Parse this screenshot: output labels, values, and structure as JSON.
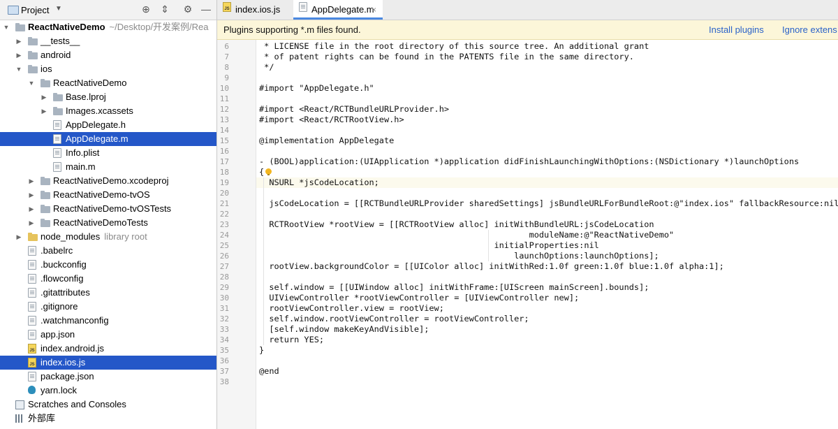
{
  "sidebar": {
    "title": "Project",
    "rows": [
      {
        "label": "ReactNativeDemo",
        "hint": "~/Desktop/开发案例/Rea",
        "bold": true,
        "depth": 0,
        "arrow": "down",
        "icon": "folder-icon",
        "iconKind": "folder"
      },
      {
        "label": "__tests__",
        "depth": 1,
        "arrow": "right",
        "icon": "folder-icon",
        "iconKind": "folder"
      },
      {
        "label": "android",
        "depth": 1,
        "arrow": "right",
        "icon": "folder-icon",
        "iconKind": "folder"
      },
      {
        "label": "ios",
        "depth": 1,
        "arrow": "down",
        "icon": "folder-icon",
        "iconKind": "folder"
      },
      {
        "label": "ReactNativeDemo",
        "depth": 2,
        "arrow": "down",
        "icon": "folder-icon",
        "iconKind": "folder"
      },
      {
        "label": "Base.lproj",
        "depth": 3,
        "arrow": "right",
        "icon": "folder-icon",
        "iconKind": "folder"
      },
      {
        "label": "Images.xcassets",
        "depth": 3,
        "arrow": "right",
        "icon": "folder-icon",
        "iconKind": "folder"
      },
      {
        "label": "AppDelegate.h",
        "depth": 3,
        "arrow": "",
        "icon": "file-icon",
        "iconKind": "file"
      },
      {
        "label": "AppDelegate.m",
        "depth": 3,
        "arrow": "",
        "icon": "file-icon",
        "iconKind": "file",
        "selected": true
      },
      {
        "label": "Info.plist",
        "depth": 3,
        "arrow": "",
        "icon": "file-icon",
        "iconKind": "file"
      },
      {
        "label": "main.m",
        "depth": 3,
        "arrow": "",
        "icon": "file-icon",
        "iconKind": "file"
      },
      {
        "label": "ReactNativeDemo.xcodeproj",
        "depth": 2,
        "arrow": "right",
        "icon": "folder-icon",
        "iconKind": "folder"
      },
      {
        "label": "ReactNativeDemo-tvOS",
        "depth": 2,
        "arrow": "right",
        "icon": "folder-icon",
        "iconKind": "folder"
      },
      {
        "label": "ReactNativeDemo-tvOSTests",
        "depth": 2,
        "arrow": "right",
        "icon": "folder-icon",
        "iconKind": "folder"
      },
      {
        "label": "ReactNativeDemoTests",
        "depth": 2,
        "arrow": "right",
        "icon": "folder-icon",
        "iconKind": "folder"
      },
      {
        "label": "node_modules",
        "hint": "library root",
        "depth": 1,
        "arrow": "right",
        "icon": "folder-icon",
        "iconKind": "folder yellow"
      },
      {
        "label": ".babelrc",
        "depth": 1,
        "arrow": "",
        "icon": "file-icon",
        "iconKind": "file"
      },
      {
        "label": ".buckconfig",
        "depth": 1,
        "arrow": "",
        "icon": "file-icon",
        "iconKind": "file"
      },
      {
        "label": ".flowconfig",
        "depth": 1,
        "arrow": "",
        "icon": "file-icon",
        "iconKind": "file"
      },
      {
        "label": ".gitattributes",
        "depth": 1,
        "arrow": "",
        "icon": "file-icon",
        "iconKind": "file"
      },
      {
        "label": ".gitignore",
        "depth": 1,
        "arrow": "",
        "icon": "file-icon",
        "iconKind": "file"
      },
      {
        "label": ".watchmanconfig",
        "depth": 1,
        "arrow": "",
        "icon": "file-icon",
        "iconKind": "file"
      },
      {
        "label": "app.json",
        "depth": 1,
        "arrow": "",
        "icon": "file-icon",
        "iconKind": "file"
      },
      {
        "label": "index.android.js",
        "depth": 1,
        "arrow": "",
        "icon": "js-file-icon",
        "iconKind": "jsfile"
      },
      {
        "label": "index.ios.js",
        "depth": 1,
        "arrow": "",
        "icon": "js-file-icon",
        "iconKind": "jsfile",
        "selected": true
      },
      {
        "label": "package.json",
        "depth": 1,
        "arrow": "",
        "icon": "file-icon",
        "iconKind": "file"
      },
      {
        "label": "yarn.lock",
        "depth": 1,
        "arrow": "",
        "icon": "yarn-icon",
        "iconKind": "yarn"
      },
      {
        "label": "Scratches and Consoles",
        "depth": 0,
        "arrow": "",
        "icon": "scratches-icon",
        "iconKind": "scratch"
      },
      {
        "label": "外部库",
        "depth": 0,
        "arrow": "",
        "icon": "libraries-icon",
        "iconKind": "libs"
      }
    ]
  },
  "tabs": [
    {
      "label": "index.ios.js",
      "active": false,
      "icon": "js-file-icon"
    },
    {
      "label": "AppDelegate.m",
      "active": true,
      "icon": "file-icon"
    }
  ],
  "banner": {
    "message": "Plugins supporting *.m files found.",
    "install": "Install plugins",
    "ignore": "Ignore extens"
  },
  "editor": {
    "current_line": 19,
    "lines": [
      {
        "n": "6",
        "text": " * LICENSE file in the root directory of this source tree. An additional grant"
      },
      {
        "n": "7",
        "text": " * of patent rights can be found in the PATENTS file in the same directory."
      },
      {
        "n": "8",
        "text": " */"
      },
      {
        "n": "9",
        "text": ""
      },
      {
        "n": "10",
        "text": "#import \"AppDelegate.h\""
      },
      {
        "n": "11",
        "text": ""
      },
      {
        "n": "12",
        "text": "#import <React/RCTBundleURLProvider.h>"
      },
      {
        "n": "13",
        "text": "#import <React/RCTRootView.h>"
      },
      {
        "n": "14",
        "text": ""
      },
      {
        "n": "15",
        "text": "@implementation AppDelegate"
      },
      {
        "n": "16",
        "text": ""
      },
      {
        "n": "17",
        "text": "- (BOOL)application:(UIApplication *)application didFinishLaunchingWithOptions:(NSDictionary *)launchOptions"
      },
      {
        "n": "18",
        "text": "{"
      },
      {
        "n": "19",
        "text": "  NSURL *jsCodeLocation;"
      },
      {
        "n": "20",
        "text": ""
      },
      {
        "n": "21",
        "text": "  jsCodeLocation = [[RCTBundleURLProvider sharedSettings] jsBundleURLForBundleRoot:@\"index.ios\" fallbackResource:nil];"
      },
      {
        "n": "22",
        "text": ""
      },
      {
        "n": "23",
        "text": "  RCTRootView *rootView = [[RCTRootView alloc] initWithBundleURL:jsCodeLocation"
      },
      {
        "n": "24",
        "text": "                                                      moduleName:@\"ReactNativeDemo\""
      },
      {
        "n": "25",
        "text": "                                               initialProperties:nil"
      },
      {
        "n": "26",
        "text": "                                                   launchOptions:launchOptions];"
      },
      {
        "n": "27",
        "text": "  rootView.backgroundColor = [[UIColor alloc] initWithRed:1.0f green:1.0f blue:1.0f alpha:1];"
      },
      {
        "n": "28",
        "text": ""
      },
      {
        "n": "29",
        "text": "  self.window = [[UIWindow alloc] initWithFrame:[UIScreen mainScreen].bounds];"
      },
      {
        "n": "30",
        "text": "  UIViewController *rootViewController = [UIViewController new];"
      },
      {
        "n": "31",
        "text": "  rootViewController.view = rootView;"
      },
      {
        "n": "32",
        "text": "  self.window.rootViewController = rootViewController;"
      },
      {
        "n": "33",
        "text": "  [self.window makeKeyAndVisible];"
      },
      {
        "n": "34",
        "text": "  return YES;"
      },
      {
        "n": "35",
        "text": "}"
      },
      {
        "n": "36",
        "text": ""
      },
      {
        "n": "37",
        "text": "@end"
      },
      {
        "n": "38",
        "text": ""
      }
    ]
  },
  "colors": {
    "selection": "#2457c8",
    "banner_bg": "#fcf6d9",
    "link": "#2a62c9",
    "tab_underline": "#4a88e0"
  }
}
